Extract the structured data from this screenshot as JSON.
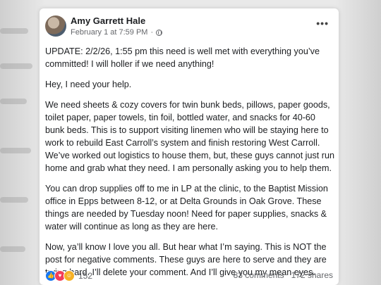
{
  "post": {
    "author": "Amy Garrett Hale",
    "timestamp": "February 1 at 7:59 PM",
    "separator": "·",
    "menu_icon": "more-options-icon",
    "paragraphs": [
      "UPDATE: 2/2/26, 1:55 pm this need is well met with everything you’ve committed! I will holler if we need anything!",
      "Hey, I need your help.",
      "We need sheets & cozy covers for twin bunk beds, pillows, paper goods, toilet paper, paper towels, tin foil, bottled water, and snacks for 40-60 bunk beds. This is to support visiting linemen who will be staying here to work to rebuild East Carroll’s system and finish restoring West Carroll. We’ve worked out logistics to house them, but, these guys cannot just run home and grab what they need. I am personally asking you to help them.",
      "You can drop supplies off to me in LP at the clinic, to the Baptist Mission office in Epps between 8-12, or at Delta Grounds in Oak Grove. These things are needed by Tuesday noon! Need for paper supplies, snacks & water will continue as long as they are here.",
      "Now, ya’ll know I love you all. But hear what I’m saying. This is NOT the post for negative comments. These guys are here to serve and they are trying hard. I’ll delete your comment. And I’ll give you my mean eyes."
    ],
    "reactions": {
      "icons": [
        "like-icon",
        "love-icon",
        "care-icon"
      ],
      "count": "152"
    },
    "comments": "83 comments",
    "shares": "172 shares"
  },
  "colors": {
    "card": "#ffffff",
    "text": "#1c1e21",
    "muted": "#65676b",
    "like": "#1877f2",
    "love": "#f33e58",
    "care": "#f7b125"
  }
}
